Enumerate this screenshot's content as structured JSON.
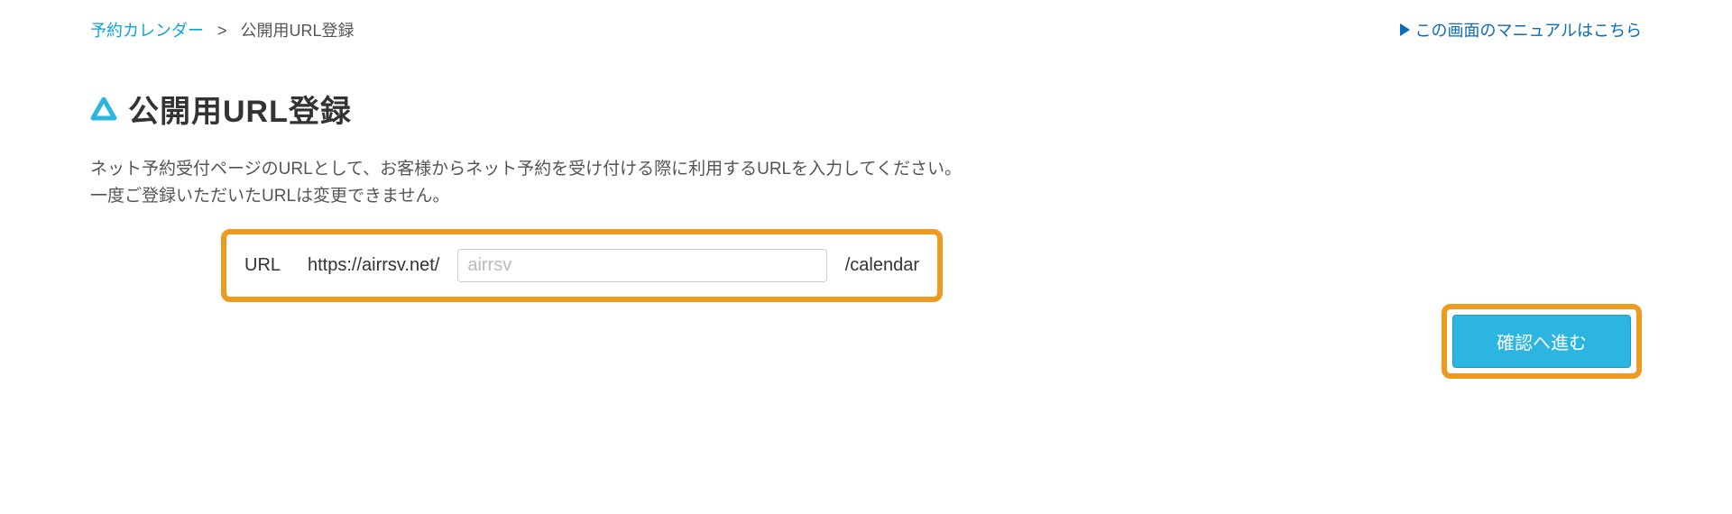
{
  "breadcrumb": {
    "parent": "予約カレンダー",
    "separator": ">",
    "current": "公開用URL登録"
  },
  "manual_link": "この画面のマニュアルはこちら",
  "page_title": "公開用URL登録",
  "description_line1": "ネット予約受付ページのURLとして、お客様からネット予約を受け付ける際に利用するURLを入力してください。",
  "description_line2": "一度ご登録いただいたURLは変更できません。",
  "url_form": {
    "label": "URL",
    "prefix": "https://airrsv.net/",
    "placeholder": "airrsv",
    "value": "",
    "suffix": "/calendar"
  },
  "confirm_button": "確認へ進む"
}
